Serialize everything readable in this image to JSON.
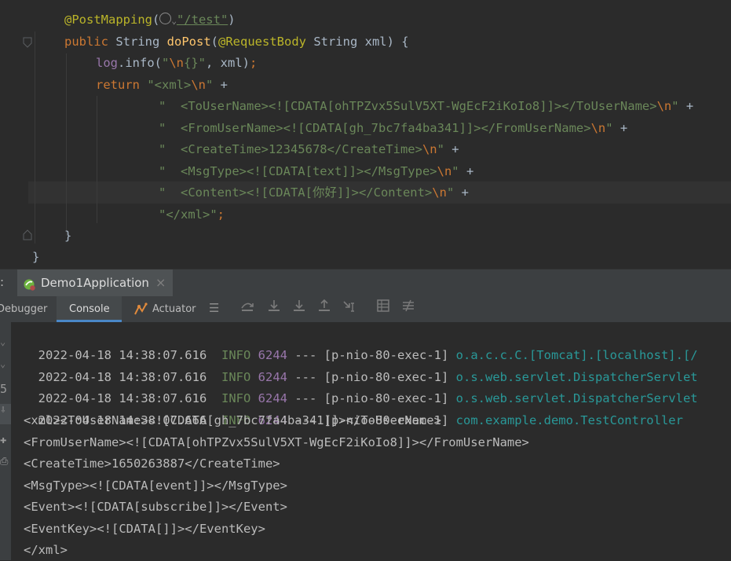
{
  "code": {
    "line1": {
      "annotation": "@PostMapping",
      "open": "(",
      "url": "\"/test\"",
      "close": ")"
    },
    "line2": {
      "kw": "public",
      "type": " String ",
      "method": "doPost",
      "params_open": "(",
      "param_ann": "@RequestBody",
      "params_rest": " String xml) {"
    },
    "line3": {
      "obj": "log",
      "call": ".info(",
      "str_a": "\"",
      "esc": "\\n",
      "str_b": "{}\"",
      "rest": ", xml)",
      "semi": ";"
    },
    "line4": {
      "kw": "return ",
      "str": "\"<xml>",
      "esc": "\\n",
      "q": "\"",
      "plus": " +"
    },
    "line5": {
      "str": "\"  <ToUserName><![CDATA[ohTPZvx5SulV5XT-WgEcF2iKoIo8]]></ToUserName>",
      "esc": "\\n",
      "q": "\"",
      "plus": " +"
    },
    "line6": {
      "str": "\"  <FromUserName><![CDATA[gh_7bc7fa4ba341]]></FromUserName>",
      "esc": "\\n",
      "q": "\"",
      "plus": " +"
    },
    "line7": {
      "str": "\"  <CreateTime>12345678</CreateTime>",
      "esc": "\\n",
      "q": "\"",
      "plus": " +"
    },
    "line8": {
      "str": "\"  <MsgType><![CDATA[text]]></MsgType>",
      "esc": "\\n",
      "q": "\"",
      "plus": " +"
    },
    "line9": {
      "str": "\"  <Content><![CDATA[你好]]></Content>",
      "esc": "\\n",
      "q": "\"",
      "plus": " +"
    },
    "line10": {
      "str": "\"</xml>\"",
      "semi": ";"
    },
    "line11": "}",
    "line12": "}"
  },
  "run_panel": {
    "prefix": ":",
    "tab_label": "Demo1Application",
    "close_glyph": "×"
  },
  "tabs": {
    "debugger": "Debugger",
    "console": "Console",
    "actuator": "Actuator"
  },
  "console": {
    "logs": [
      {
        "time": "2022-04-18 14:38:07.616",
        "level": "INFO",
        "pid": "6244",
        "sep": "---",
        "thread": "[p-nio-80-exec-1]",
        "logger": "o.a.c.c.C.[Tomcat].[localhost].[/"
      },
      {
        "time": "2022-04-18 14:38:07.616",
        "level": "INFO",
        "pid": "6244",
        "sep": "---",
        "thread": "[p-nio-80-exec-1]",
        "logger": "o.s.web.servlet.DispatcherServlet"
      },
      {
        "time": "2022-04-18 14:38:07.616",
        "level": "INFO",
        "pid": "6244",
        "sep": "---",
        "thread": "[p-nio-80-exec-1]",
        "logger": "o.s.web.servlet.DispatcherServlet"
      },
      {
        "time": "2022-04-18 14:38:07.666",
        "level": "INFO",
        "pid": "6244",
        "sep": "---",
        "thread": "[p-nio-80-exec-1]",
        "logger": "com.example.demo.TestController"
      }
    ],
    "xml_lines": [
      "<xml><ToUserName><![CDATA[gh_7bc7fa4ba341]]></ToUserName>",
      "<FromUserName><![CDATA[ohTPZvx5SulV5XT-WgEcF2iKoIo8]]></FromUserName>",
      "<CreateTime>1650263887</CreateTime>",
      "<MsgType><![CDATA[event]]></MsgType>",
      "<Event><![CDATA[subscribe]]></Event>",
      "<EventKey><![CDATA[]]></EventKey>",
      "</xml>"
    ]
  },
  "icons": {
    "run_config": "spring-boot-icon",
    "actuator": "actuator-icon",
    "left_strip": [
      "rerun-icon",
      "scroll-to-end-icon",
      "pin-icon",
      "print-icon"
    ],
    "toolbar": [
      "menu-icon",
      "step-over-icon",
      "step-into-icon",
      "force-step-into-icon",
      "step-out-icon",
      "run-to-cursor-icon",
      "evaluate-icon",
      "trace-icon"
    ]
  },
  "colors": {
    "editor_bg": "#2b2b2b",
    "keyword": "#cc7832",
    "string": "#6a8759",
    "annotation": "#bbb529",
    "method": "#ffc66d",
    "field": "#9876aa",
    "logger": "#299999"
  }
}
